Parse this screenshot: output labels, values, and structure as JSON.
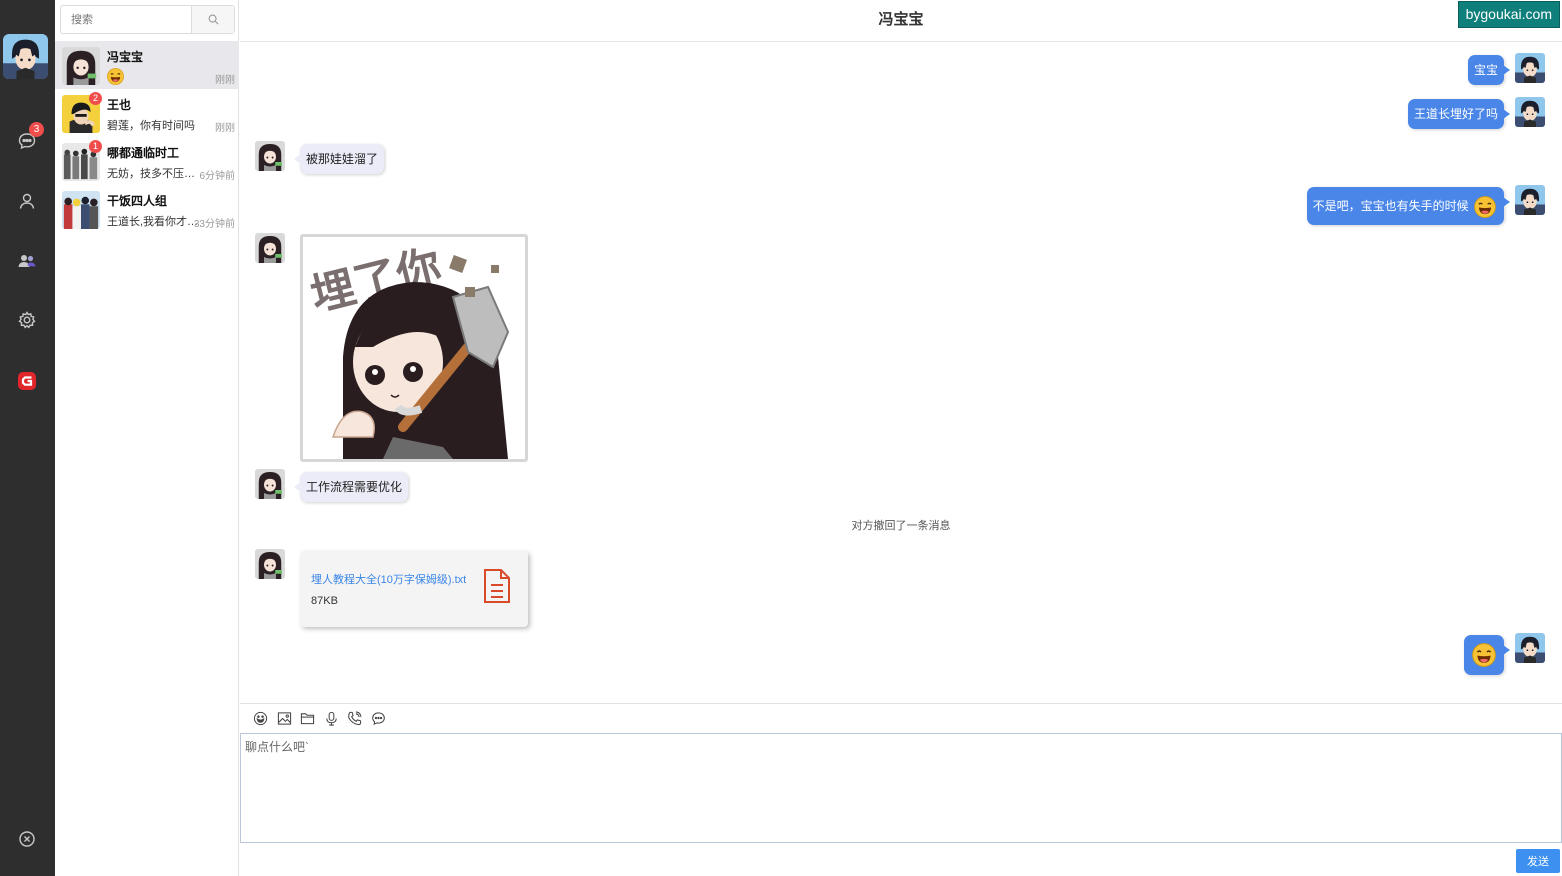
{
  "rail": {
    "message_badge": "3"
  },
  "search": {
    "placeholder": "搜索"
  },
  "contacts": [
    {
      "name": "冯宝宝",
      "last_message": "",
      "time": "刚刚",
      "badge": ""
    },
    {
      "name": "王也",
      "last_message": "碧莲，你有时间吗",
      "time": "刚刚",
      "badge": "2"
    },
    {
      "name": "哪都通临时工",
      "last_message": "无妨，技多不压身嘛",
      "time": "6分钟前",
      "badge": "1"
    },
    {
      "name": "干饭四人组",
      "last_message": "王道长,我看你才…",
      "time": "33分钟前",
      "badge": ""
    }
  ],
  "chat": {
    "title": "冯宝宝",
    "watermark": "bygoukai.com",
    "recall_notice": "对方撤回了一条消息",
    "messages": [
      {
        "side": "out",
        "text": "宝宝"
      },
      {
        "side": "out",
        "text": "王道长埋好了吗"
      },
      {
        "side": "in",
        "text": "被那娃娃溜了"
      },
      {
        "side": "out",
        "text": "不是吧，宝宝也有失手的时候"
      },
      {
        "side": "in",
        "text": "工作流程需要优化"
      }
    ],
    "sticker_text": "埋了你",
    "file": {
      "name": "埋人教程大全(10万字保姆级).txt",
      "size": "87KB"
    }
  },
  "composer": {
    "placeholder": "聊点什么吧`",
    "send_label": "发送"
  },
  "colors": {
    "rail_bg": "#2e2e2e",
    "outgoing_bubble": "#4a86e8",
    "incoming_bubble": "#ececf8",
    "badge": "#f14d4d",
    "send_button": "#3d8ff0"
  }
}
